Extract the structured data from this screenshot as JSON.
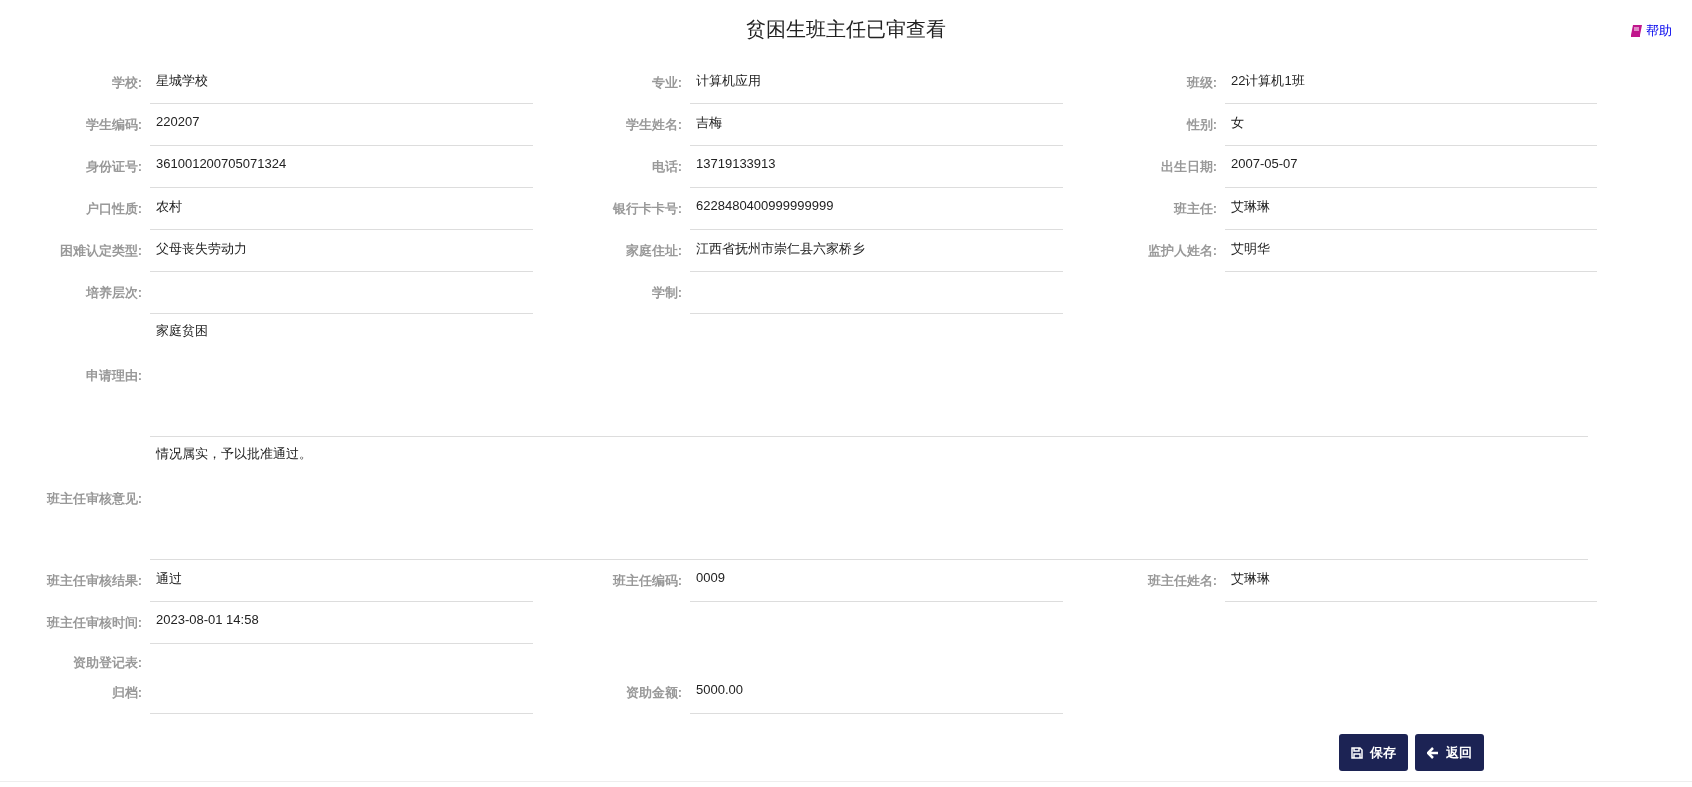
{
  "header": {
    "title": "贫困生班主任已审查看",
    "help_link": "帮助"
  },
  "rows": [
    {
      "kind": "fields",
      "fields": [
        {
          "label": "学校:",
          "value": "星城学校"
        },
        {
          "label": "专业:",
          "value": "计算机应用"
        },
        {
          "label": "班级:",
          "value": "22计算机1班"
        }
      ]
    },
    {
      "kind": "fields",
      "fields": [
        {
          "label": "学生编码:",
          "value": "220207"
        },
        {
          "label": "学生姓名:",
          "value": "吉梅"
        },
        {
          "label": "性别:",
          "value": "女"
        }
      ]
    },
    {
      "kind": "fields",
      "fields": [
        {
          "label": "身份证号:",
          "value": "361001200705071324"
        },
        {
          "label": "电话:",
          "value": "13719133913"
        },
        {
          "label": "出生日期:",
          "value": "2007-05-07"
        }
      ]
    },
    {
      "kind": "fields",
      "fields": [
        {
          "label": "户口性质:",
          "value": "农村"
        },
        {
          "label": "银行卡卡号:",
          "value": "6228480400999999999"
        },
        {
          "label": "班主任:",
          "value": "艾琳琳"
        }
      ]
    },
    {
      "kind": "fields",
      "fields": [
        {
          "label": "困难认定类型:",
          "value": "父母丧失劳动力"
        },
        {
          "label": "家庭住址:",
          "value": "江西省抚州市崇仁县六家桥乡"
        },
        {
          "label": "监护人姓名:",
          "value": "艾明华"
        }
      ]
    },
    {
      "kind": "fields",
      "fields": [
        {
          "label": "培养层次:"
        },
        {
          "label": "学制:"
        }
      ]
    },
    {
      "kind": "area",
      "fields": [
        {
          "label": "申请理由:",
          "value": "家庭贫困"
        }
      ]
    },
    {
      "kind": "area",
      "fields": [
        {
          "label": "班主任审核意见:",
          "value": "情况属实，予以批准通过。"
        }
      ]
    },
    {
      "kind": "fields",
      "fields": [
        {
          "label": "班主任审核结果:",
          "value": "通过"
        },
        {
          "label": "班主任编码:",
          "value": "0009"
        },
        {
          "label": "班主任姓名:",
          "value": "艾琳琳"
        }
      ]
    },
    {
      "kind": "fields",
      "fields": [
        {
          "label": "班主任审核时间:",
          "value": "2023-08-01 14:58"
        }
      ]
    },
    {
      "kind": "label",
      "fields": [
        {
          "label": "资助登记表:"
        }
      ]
    },
    {
      "kind": "fields",
      "fields": [
        {
          "label": "归档:"
        },
        {
          "label": "资助金额:",
          "value": "5000.00"
        }
      ]
    }
  ],
  "buttons": [
    {
      "kind": "save",
      "label": "保存"
    },
    {
      "kind": "back",
      "label": "返回"
    }
  ]
}
